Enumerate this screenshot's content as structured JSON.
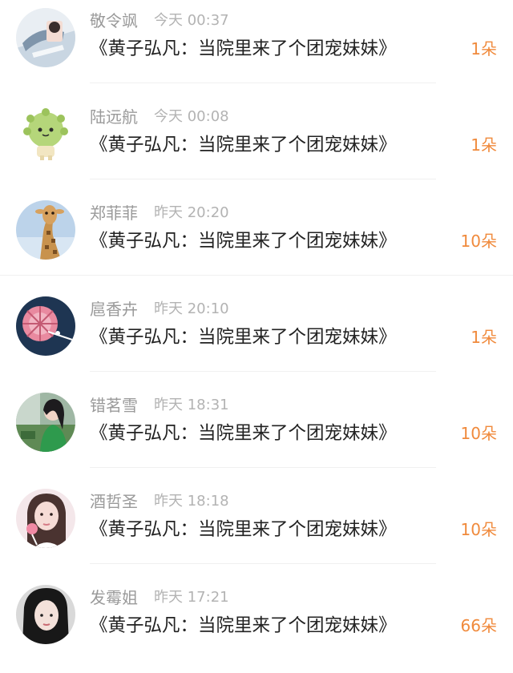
{
  "comments": [
    {
      "name": "敬令飒",
      "time": "今天 00:37",
      "text": "《黄子弘凡：当院里来了个团宠妹妹》",
      "count": "1朵",
      "avatar": "anime-illustration-avatar"
    },
    {
      "name": "陆远航",
      "time": "今天 00:08",
      "text": "《黄子弘凡：当院里来了个团宠妹妹》",
      "count": "1朵",
      "avatar": "green-plush-creature-avatar"
    },
    {
      "name": "郑菲菲",
      "time": "昨天 20:20",
      "text": "《黄子弘凡：当院里来了个团宠妹妹》",
      "count": "10朵",
      "avatar": "giraffe-avatar"
    },
    {
      "name": "扈香卉",
      "time": "昨天 20:10",
      "text": "《黄子弘凡：当院里来了个团宠妹妹》",
      "count": "1朵",
      "avatar": "pink-flower-art-avatar"
    },
    {
      "name": "错茗雪",
      "time": "昨天 18:31",
      "text": "《黄子弘凡：当院里来了个团宠妹妹》",
      "count": "10朵",
      "avatar": "girl-outdoors-avatar"
    },
    {
      "name": "酒哲圣",
      "time": "昨天 18:18",
      "text": "《黄子弘凡：当院里来了个团宠妹妹》",
      "count": "10朵",
      "avatar": "girl-with-lollipop-avatar"
    },
    {
      "name": "发霉姐",
      "time": "昨天 17:21",
      "text": "《黄子弘凡：当院里来了个团宠妹妹》",
      "count": "66朵",
      "avatar": "dark-hair-girl-avatar"
    }
  ],
  "colors": {
    "count_accent": "#f08a3c",
    "name_gray": "#9a9a9a",
    "time_gray": "#b3b3b3",
    "text_dark": "#222222"
  }
}
